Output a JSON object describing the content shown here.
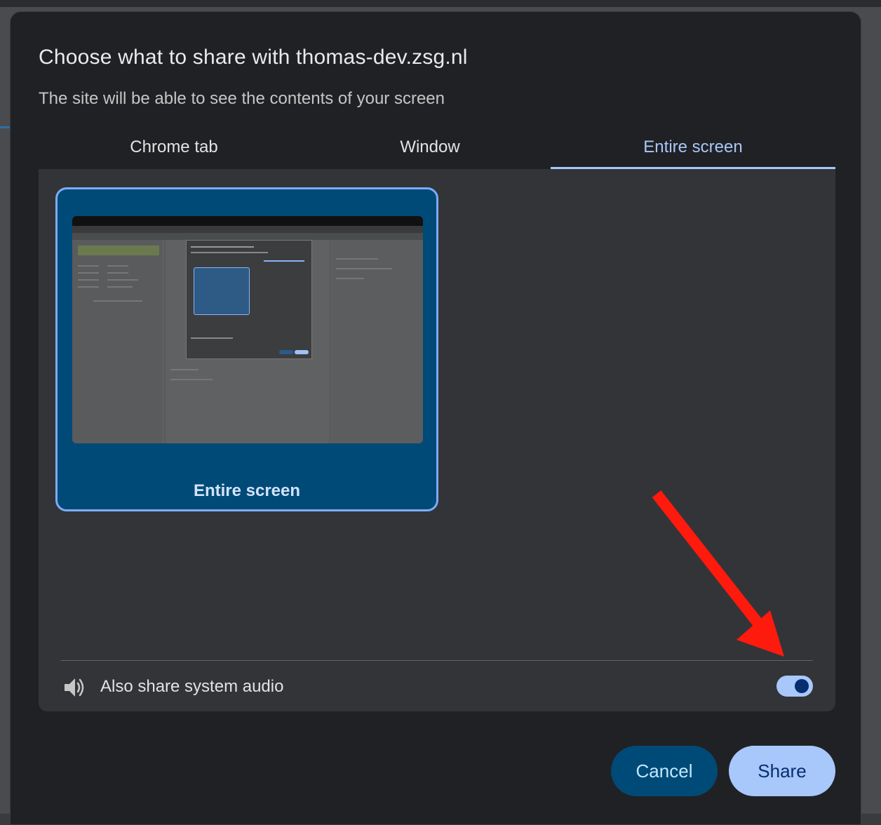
{
  "dialog": {
    "title": "Choose what to share with thomas-dev.zsg.nl",
    "subtitle": "The site will be able to see the contents of your screen"
  },
  "tabs": [
    {
      "label": "Chrome tab",
      "selected": false
    },
    {
      "label": "Window",
      "selected": false
    },
    {
      "label": "Entire screen",
      "selected": true
    }
  ],
  "sources": [
    {
      "label": "Entire screen",
      "selected": true
    }
  ],
  "audio": {
    "label": "Also share system audio",
    "enabled": true,
    "icon": "speaker-icon"
  },
  "buttons": {
    "cancel": "Cancel",
    "share": "Share"
  },
  "annotation": {
    "icon": "red-arrow-icon",
    "color": "#ff1a0e"
  },
  "colors": {
    "dialog_bg": "#202124",
    "panel_bg": "#333438",
    "accent": "#a8c7fa",
    "card_bg": "#004a77"
  }
}
